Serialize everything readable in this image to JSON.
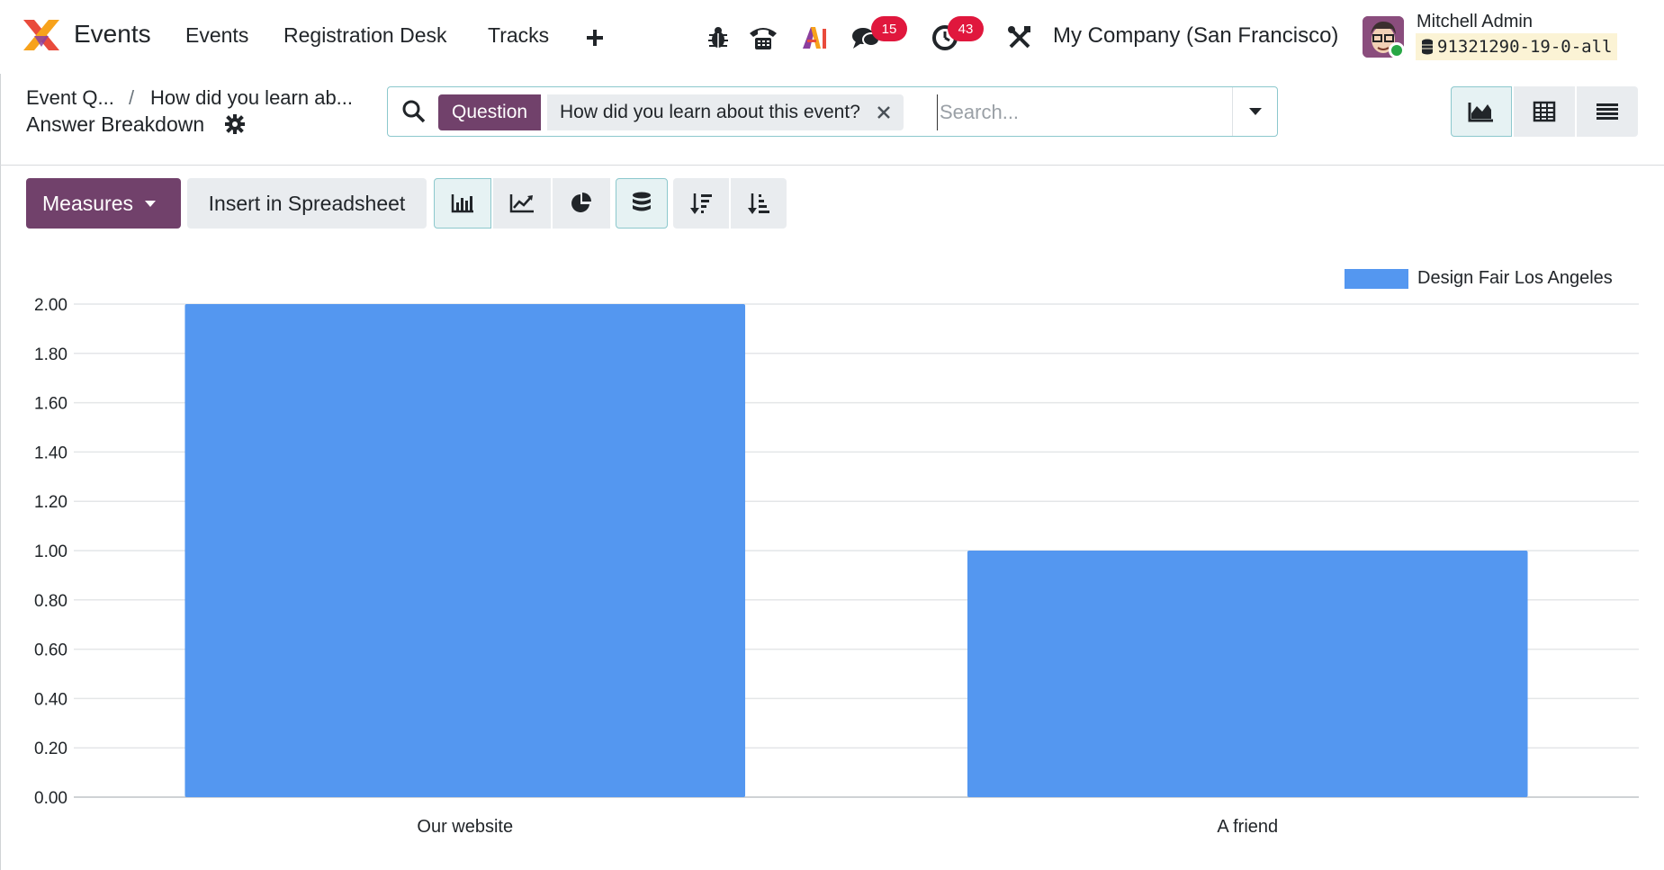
{
  "navbar": {
    "app_name": "Events",
    "menu": [
      "Events",
      "Registration Desk",
      "Tracks"
    ],
    "messages_count": "15",
    "activities_count": "43",
    "company": "My Company (San Francisco)",
    "user_name": "Mitchell Admin",
    "db_name": "91321290-19-0-all"
  },
  "breadcrumb": {
    "parent": "Event Q...",
    "separator": "/",
    "current": "How did you learn ab...",
    "title": "Answer Breakdown"
  },
  "search": {
    "facet_label": "Question",
    "facet_value": "How did you learn about this event?",
    "placeholder": "Search..."
  },
  "toolbar": {
    "measures_label": "Measures",
    "insert_label": "Insert in Spreadsheet"
  },
  "colors": {
    "brand": "#71416b",
    "bar": "#5497f0",
    "badge": "#e0173d",
    "active_border": "#8cc8cd"
  },
  "chart_data": {
    "type": "bar",
    "categories": [
      "Our website",
      "A friend"
    ],
    "series": [
      {
        "name": "Design Fair Los Angeles",
        "values": [
          2,
          1
        ]
      }
    ],
    "ylim": [
      0,
      2
    ],
    "yticks": [
      "0.00",
      "0.20",
      "0.40",
      "0.60",
      "0.80",
      "1.00",
      "1.20",
      "1.40",
      "1.60",
      "1.80",
      "2.00"
    ],
    "grid": true,
    "legend_position": "top-right"
  }
}
